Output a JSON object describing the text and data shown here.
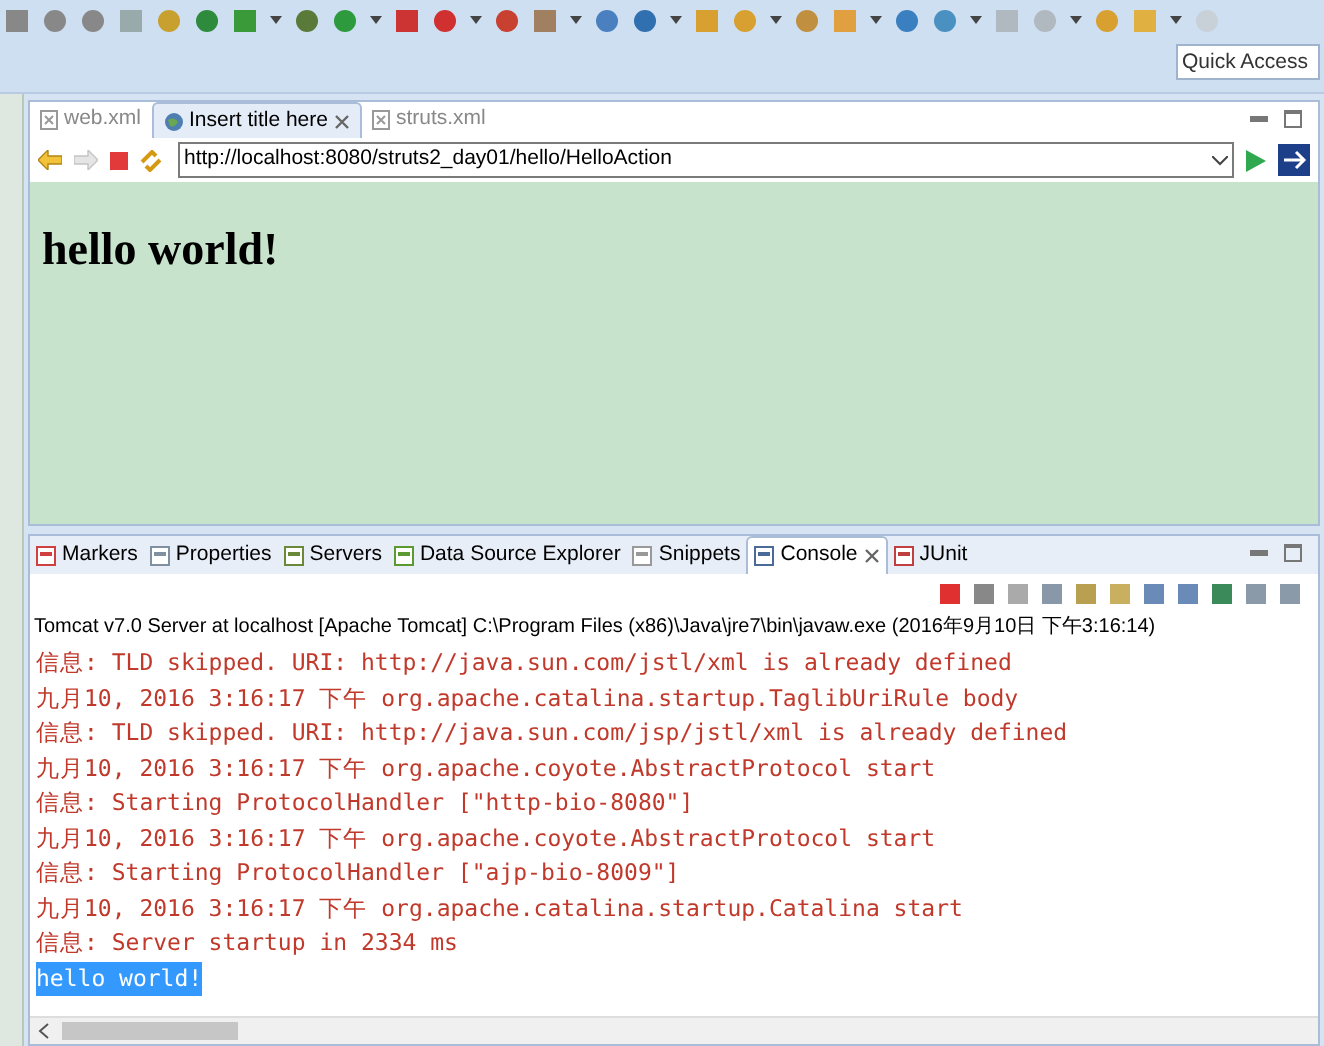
{
  "quick_access": {
    "placeholder": "Quick Access"
  },
  "editor_tabs": [
    {
      "label": "web.xml",
      "kind": "xml",
      "selected": false
    },
    {
      "label": "Insert title here",
      "kind": "web",
      "selected": true
    },
    {
      "label": "struts.xml",
      "kind": "xml",
      "selected": false
    }
  ],
  "browser": {
    "url": "http://localhost:8080/struts2_day01/hello/HelloAction",
    "heading": "hello world!"
  },
  "panel_tabs": [
    {
      "label": "Markers",
      "selected": false
    },
    {
      "label": "Properties",
      "selected": false
    },
    {
      "label": "Servers",
      "selected": false
    },
    {
      "label": "Data Source Explorer",
      "selected": false
    },
    {
      "label": "Snippets",
      "selected": false
    },
    {
      "label": "Console",
      "selected": true
    },
    {
      "label": "JUnit",
      "selected": false
    }
  ],
  "console": {
    "title": "Tomcat v7.0 Server at localhost [Apache Tomcat] C:\\Program Files (x86)\\Java\\jre7\\bin\\javaw.exe (2016年9月10日 下午3:16:14)",
    "lines": [
      {
        "text": "信息: TLD skipped. URI: http://java.sun.com/jstl/xml is already defined",
        "kind": "err",
        "selected": false
      },
      {
        "text": "九月10, 2016 3:16:17 下午 org.apache.catalina.startup.TaglibUriRule body",
        "kind": "err",
        "selected": false
      },
      {
        "text": "信息: TLD skipped. URI: http://java.sun.com/jsp/jstl/xml is already defined",
        "kind": "err",
        "selected": false
      },
      {
        "text": "九月10, 2016 3:16:17 下午 org.apache.coyote.AbstractProtocol start",
        "kind": "err",
        "selected": false
      },
      {
        "text": "信息: Starting ProtocolHandler [\"http-bio-8080\"]",
        "kind": "err",
        "selected": false
      },
      {
        "text": "九月10, 2016 3:16:17 下午 org.apache.coyote.AbstractProtocol start",
        "kind": "err",
        "selected": false
      },
      {
        "text": "信息: Starting ProtocolHandler [\"ajp-bio-8009\"]",
        "kind": "err",
        "selected": false
      },
      {
        "text": "九月10, 2016 3:16:17 下午 org.apache.catalina.startup.Catalina start",
        "kind": "err",
        "selected": false
      },
      {
        "text": "信息: Server startup in 2334 ms",
        "kind": "err",
        "selected": false
      },
      {
        "text": "hello world!",
        "kind": "out",
        "selected": true
      }
    ]
  }
}
